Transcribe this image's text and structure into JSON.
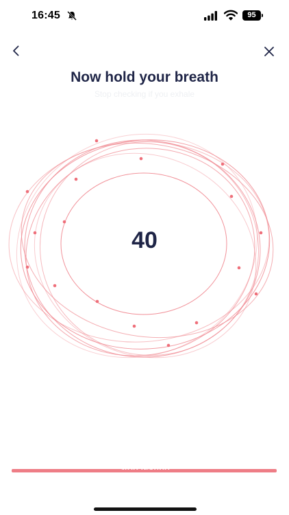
{
  "status_bar": {
    "time": "16:45",
    "battery_level": "95",
    "icons": [
      "bell-slash-icon",
      "cellular-signal-icon",
      "wifi-icon",
      "battery-icon"
    ]
  },
  "nav": {
    "back_icon": "chevron-left-icon",
    "close_icon": "close-icon"
  },
  "header": {
    "title": "Now hold your breath",
    "subtitle": "Stop checking if you exhale"
  },
  "breath": {
    "count": "40"
  },
  "footer": {
    "stop_label": "Stop testing"
  },
  "colors": {
    "accent": "#ee7d86",
    "ring": "#f08a92",
    "title": "#1f2547"
  }
}
